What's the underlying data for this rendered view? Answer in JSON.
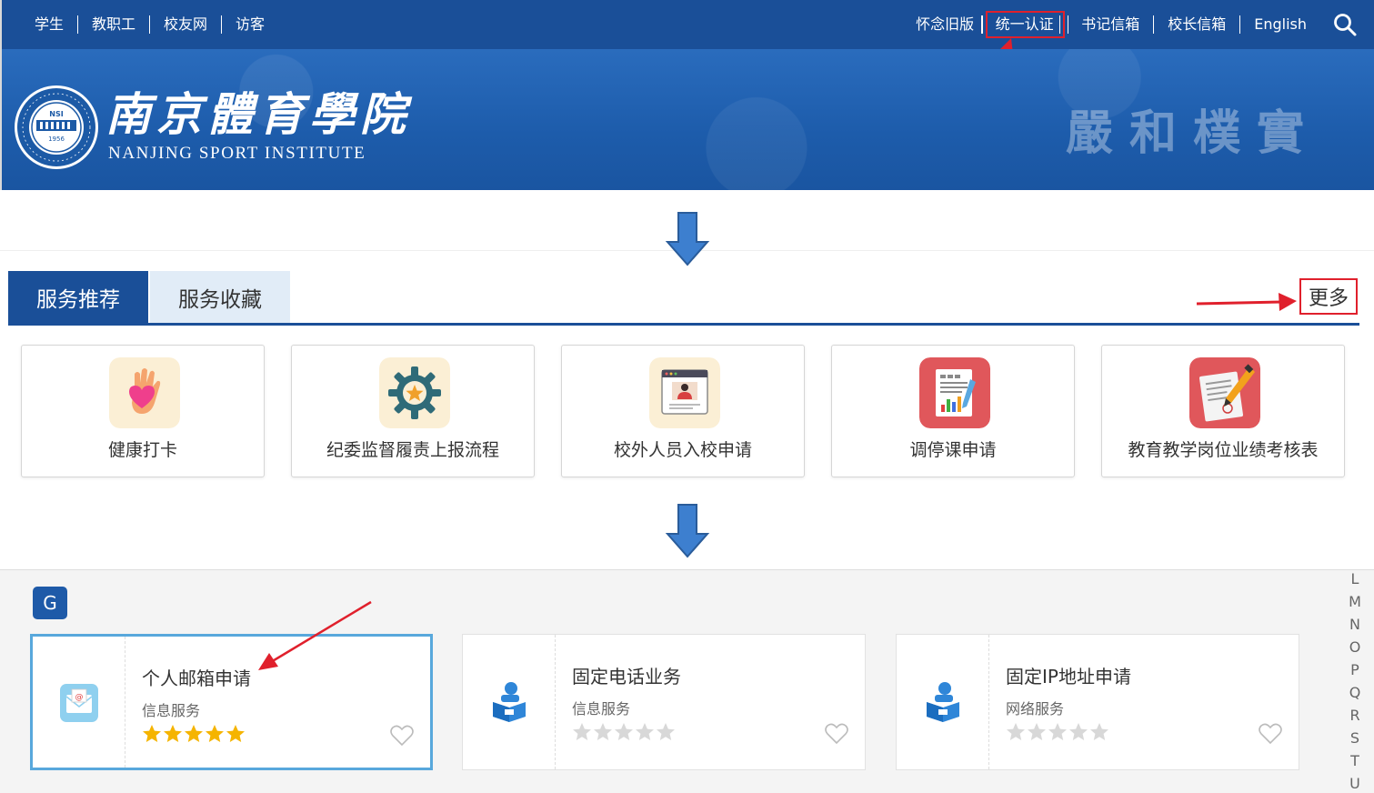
{
  "top_nav": {
    "left": [
      "学生",
      "教职工",
      "校友网",
      "访客"
    ],
    "right": [
      "怀念旧版",
      "统一认证",
      "书记信箱",
      "校长信箱",
      "English"
    ]
  },
  "banner": {
    "logo_cn": "南京體育學院",
    "logo_en": "NANJING SPORT INSTITUTE",
    "seal_top": "NSI",
    "seal_year": "1956",
    "motto": "嚴和樸實"
  },
  "tabs": {
    "active": "服务推荐",
    "inactive": "服务收藏",
    "more": "更多"
  },
  "services": [
    {
      "label": "健康打卡",
      "icon": "heart-hand-icon"
    },
    {
      "label": "纪委监督履责上报流程",
      "icon": "gear-star-icon"
    },
    {
      "label": "校外人员入校申请",
      "icon": "browser-person-icon"
    },
    {
      "label": "调停课申请",
      "icon": "report-chart-icon"
    },
    {
      "label": "教育教学岗位业绩考核表",
      "icon": "document-pen-icon"
    }
  ],
  "section": {
    "letter": "G",
    "alphabet": [
      "L",
      "M",
      "N",
      "O",
      "P",
      "Q",
      "R",
      "S",
      "T",
      "U"
    ],
    "cards": [
      {
        "title": "个人邮箱申请",
        "category": "信息服务",
        "rating": 5,
        "icon": "mail-envelope-icon"
      },
      {
        "title": "固定电话业务",
        "category": "信息服务",
        "rating": 0,
        "icon": "user-box-icon"
      },
      {
        "title": "固定IP地址申请",
        "category": "网络服务",
        "rating": 0,
        "icon": "user-box-icon"
      }
    ]
  },
  "colors": {
    "primary": "#1a4f98",
    "banner": "#2262b0",
    "annotation_red": "#e0202c",
    "star_gold": "#f5b400",
    "star_grey": "#d8d8d8",
    "selected_border": "#58a8dc"
  }
}
